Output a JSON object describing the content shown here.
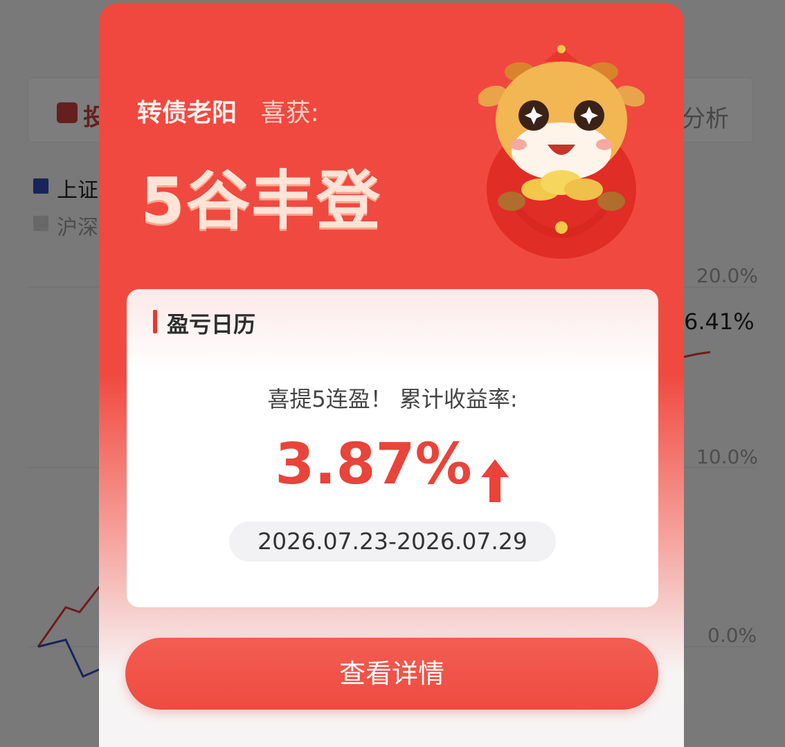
{
  "background": {
    "header_left_text": "投",
    "header_right_text": "分析",
    "legend": [
      {
        "label": "上证",
        "color": "#2f4bb5"
      },
      {
        "label": "沪深",
        "color": "#d0d0d0"
      }
    ],
    "y_axis_labels": [
      "20.0%",
      "10.0%",
      "0.0%"
    ],
    "current_value": "6.41%",
    "line_colors": {
      "portfolio": "#d93a31",
      "index": "#2f4bb5"
    }
  },
  "modal": {
    "user_name": "转债老阳",
    "gain_label": "喜获:",
    "achievement": "5谷丰登",
    "mascot_icon": "ox-mascot-holding-gold-icon",
    "card": {
      "title": "盈亏日历",
      "streak_text": "喜提5连盈！ 累计收益率:",
      "return_value": "3.87%",
      "trend_icon": "up-arrow-icon",
      "date_range": "2026.07.23-2026.07.29"
    },
    "detail_button_label": "查看详情"
  },
  "colors": {
    "accent": "#ee4b40",
    "return_text": "#e8443a"
  }
}
